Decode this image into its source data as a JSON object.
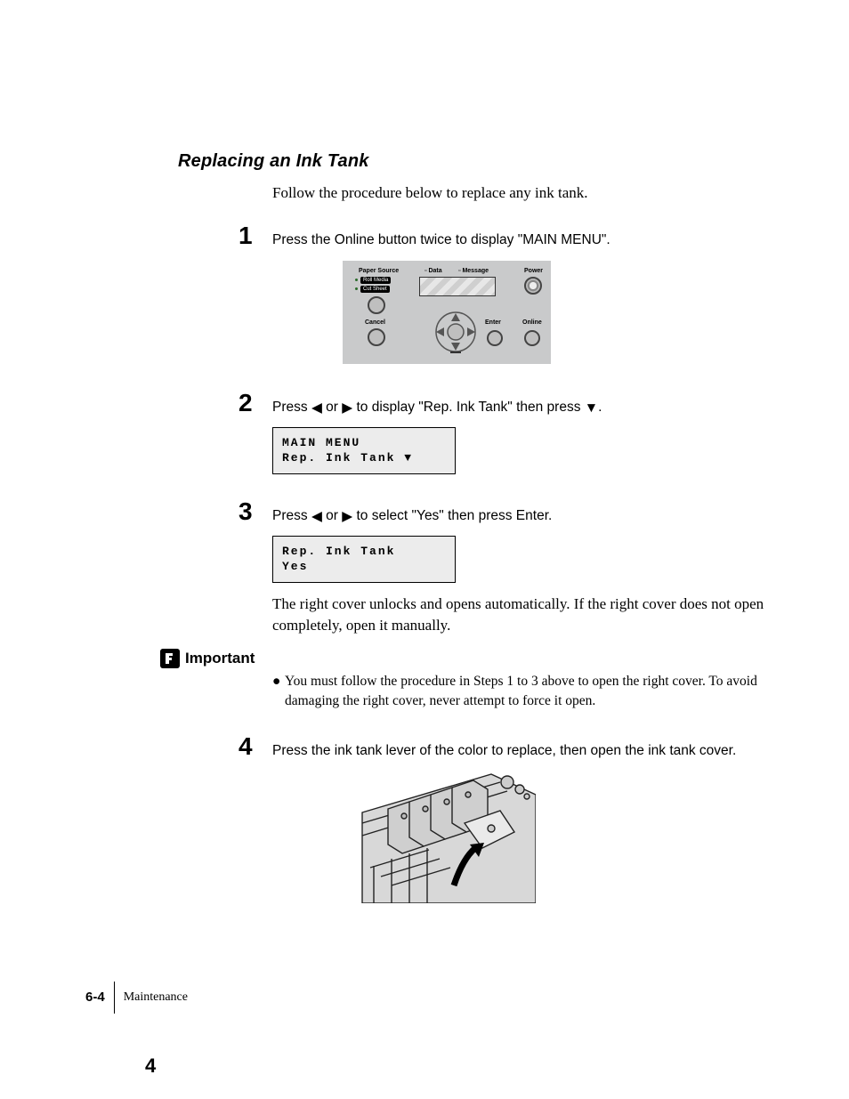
{
  "heading": "Replacing an Ink Tank",
  "intro": "Follow the procedure below to replace any ink tank.",
  "steps": {
    "s1": {
      "num": "1",
      "text": "Press the Online button twice to display \"MAIN MENU\"."
    },
    "s2": {
      "num": "2",
      "pre": "Press ",
      "mid": " or ",
      "post1": " to display \"Rep. Ink Tank\" then press ",
      "post2": "."
    },
    "s3": {
      "num": "3",
      "pre": "Press ",
      "mid": " or ",
      "post": " to select \"Yes\" then press Enter.",
      "after": "The right cover unlocks and opens automatically. If the right cover does not open completely, open it manually."
    },
    "s4": {
      "num": "4",
      "text": "Press the ink tank lever of the color to replace, then open the ink tank cover."
    }
  },
  "panel": {
    "paperSource": "Paper Source",
    "rollMedia": "Roll Media",
    "cutSheet": "Cut Sheet",
    "cancel": "Cancel",
    "data": "Data",
    "message": "Message",
    "power": "Power",
    "enter": "Enter",
    "online": "Online"
  },
  "lcd1": {
    "l1": "MAIN MENU",
    "l2": " Rep. Ink Tank ▼"
  },
  "lcd2": {
    "l1": "Rep. Ink Tank",
    "l2": "      Yes"
  },
  "important": {
    "label": "Important",
    "bullet": "You must follow the procedure in Steps 1 to 3 above to open the right cover. To avoid damaging the right cover, never attempt to force it open."
  },
  "footer": {
    "page": "6-4",
    "section": "Maintenance"
  },
  "bigNumber": "4"
}
